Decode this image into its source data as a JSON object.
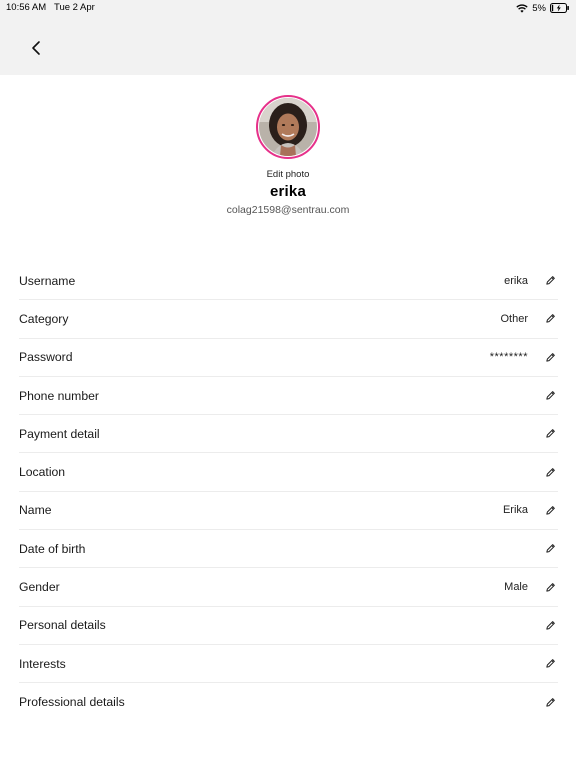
{
  "status_bar": {
    "time": "10:56 AM",
    "date": "Tue 2 Apr",
    "battery": "5%"
  },
  "nav": {
    "back_icon": "chevron-left-icon"
  },
  "profile": {
    "edit_photo_label": "Edit photo",
    "username": "erika",
    "email": "colag21598@sentrau.com",
    "avatar_ring_color": "#e6318a"
  },
  "settings": {
    "rows": [
      {
        "label": "Username",
        "value": "erika"
      },
      {
        "label": "Category",
        "value": "Other"
      },
      {
        "label": "Password",
        "value": "********"
      },
      {
        "label": "Phone number",
        "value": ""
      },
      {
        "label": "Payment detail",
        "value": ""
      },
      {
        "label": "Location",
        "value": ""
      },
      {
        "label": "Name",
        "value": "Erika"
      },
      {
        "label": "Date of birth",
        "value": ""
      },
      {
        "label": "Gender",
        "value": "Male"
      },
      {
        "label": "Personal details",
        "value": ""
      },
      {
        "label": "Interests",
        "value": ""
      },
      {
        "label": "Professional details",
        "value": ""
      }
    ],
    "edit_icon": "pencil-icon"
  }
}
